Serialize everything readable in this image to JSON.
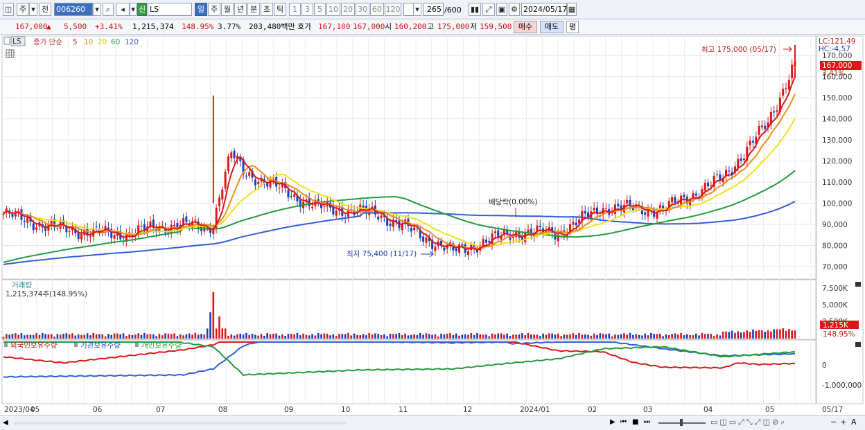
{
  "toolbar": {
    "type_label": "주",
    "prev_label": "전",
    "code": "006260",
    "sin_label": "신",
    "name": "LS",
    "periods": [
      "일",
      "주",
      "월",
      "년",
      "분",
      "초",
      "틱"
    ],
    "numbers": [
      "1",
      "3",
      "5",
      "10",
      "20",
      "30",
      "60",
      "120"
    ],
    "count": "265",
    "count_total": "/600",
    "date": "2024/05/17"
  },
  "quote": {
    "price": "167,000",
    "change": "5,500",
    "rate": "+3.41%",
    "volume": "1,215,374",
    "vol_ratio": "148.95%",
    "turnover": "3.77%",
    "amount": "203,480백만",
    "ask_label": "호가",
    "ask": "167,100",
    "bid": "167,000",
    "open_label": "시",
    "open": "160,200",
    "high_label": "고",
    "high": "175,000",
    "low_label": "저",
    "low": "159,500",
    "buy_label": "매수",
    "sell_label": "매도",
    "avg_label": "평"
  },
  "price_panel": {
    "ticker_tag": "LS",
    "ma_title": "종가 단순",
    "ma_periods": [
      "5",
      "10",
      "20",
      "60",
      "120"
    ],
    "ma_colors": [
      "#d81818",
      "#f08c1a",
      "#f0e020",
      "#249a3c",
      "#2f5fd8"
    ],
    "lc": "LC:121,49",
    "hc": "HC:-4,57",
    "last_price": "167,000",
    "last_rate": "3.41%",
    "high_note": "최고 175,000 (05/17)",
    "low_note": "최저 75,400 (11/17)",
    "dividend_note": "배당락(0.00%)",
    "y_ticks": [
      "170,000",
      "160,000",
      "150,000",
      "140,000",
      "130,000",
      "120,000",
      "110,000",
      "100,000",
      "90,000",
      "80,000",
      "70,000"
    ]
  },
  "volume_panel": {
    "title": "거래량",
    "value": "1,215,374주(148.95%)",
    "y_ticks": [
      "7,500K",
      "5,000K",
      "2,500K"
    ],
    "last_value": "1,215K",
    "last_rate": "148.95%"
  },
  "holding_panel": {
    "legend": [
      "외국인보유수량",
      "기관보유수량",
      "개인보유수량"
    ],
    "colors": [
      "#d81818",
      "#2f5fd8",
      "#249a3c"
    ],
    "y_ticks": [
      "0",
      "-1,000,000"
    ]
  },
  "x_axis": [
    "2023/04",
    "05",
    "06",
    "07",
    "08",
    "09",
    "10",
    "11",
    "12",
    "2024/01",
    "02",
    "03",
    "04",
    "05",
    "05/17"
  ],
  "chart_data": {
    "type": "candlestick",
    "title": "LS",
    "y_range": [
      70000,
      175000
    ],
    "highest": {
      "value": 175000,
      "date": "05/17"
    },
    "lowest": {
      "value": 75400,
      "date": "11/17"
    },
    "close_points": [
      {
        "t": "2023/04",
        "close": 95000
      },
      {
        "t": "2023/05",
        "close": 88000
      },
      {
        "t": "2023/06",
        "close": 85000
      },
      {
        "t": "2023/07",
        "close": 90000
      },
      {
        "t": "2023/07 late",
        "close": 88000
      },
      {
        "t": "2023/08",
        "close": 118000
      },
      {
        "t": "2023/09",
        "close": 98000
      },
      {
        "t": "2023/10",
        "close": 95000
      },
      {
        "t": "2023/11",
        "close": 77000
      },
      {
        "t": "2023/12",
        "close": 86000
      },
      {
        "t": "2024/01",
        "close": 86000
      },
      {
        "t": "2024/02",
        "close": 98000
      },
      {
        "t": "2024/03",
        "close": 97000
      },
      {
        "t": "2024/04",
        "close": 112000
      },
      {
        "t": "2024/05",
        "close": 138000
      },
      {
        "t": "2024/05/17",
        "close": 167000
      }
    ]
  }
}
